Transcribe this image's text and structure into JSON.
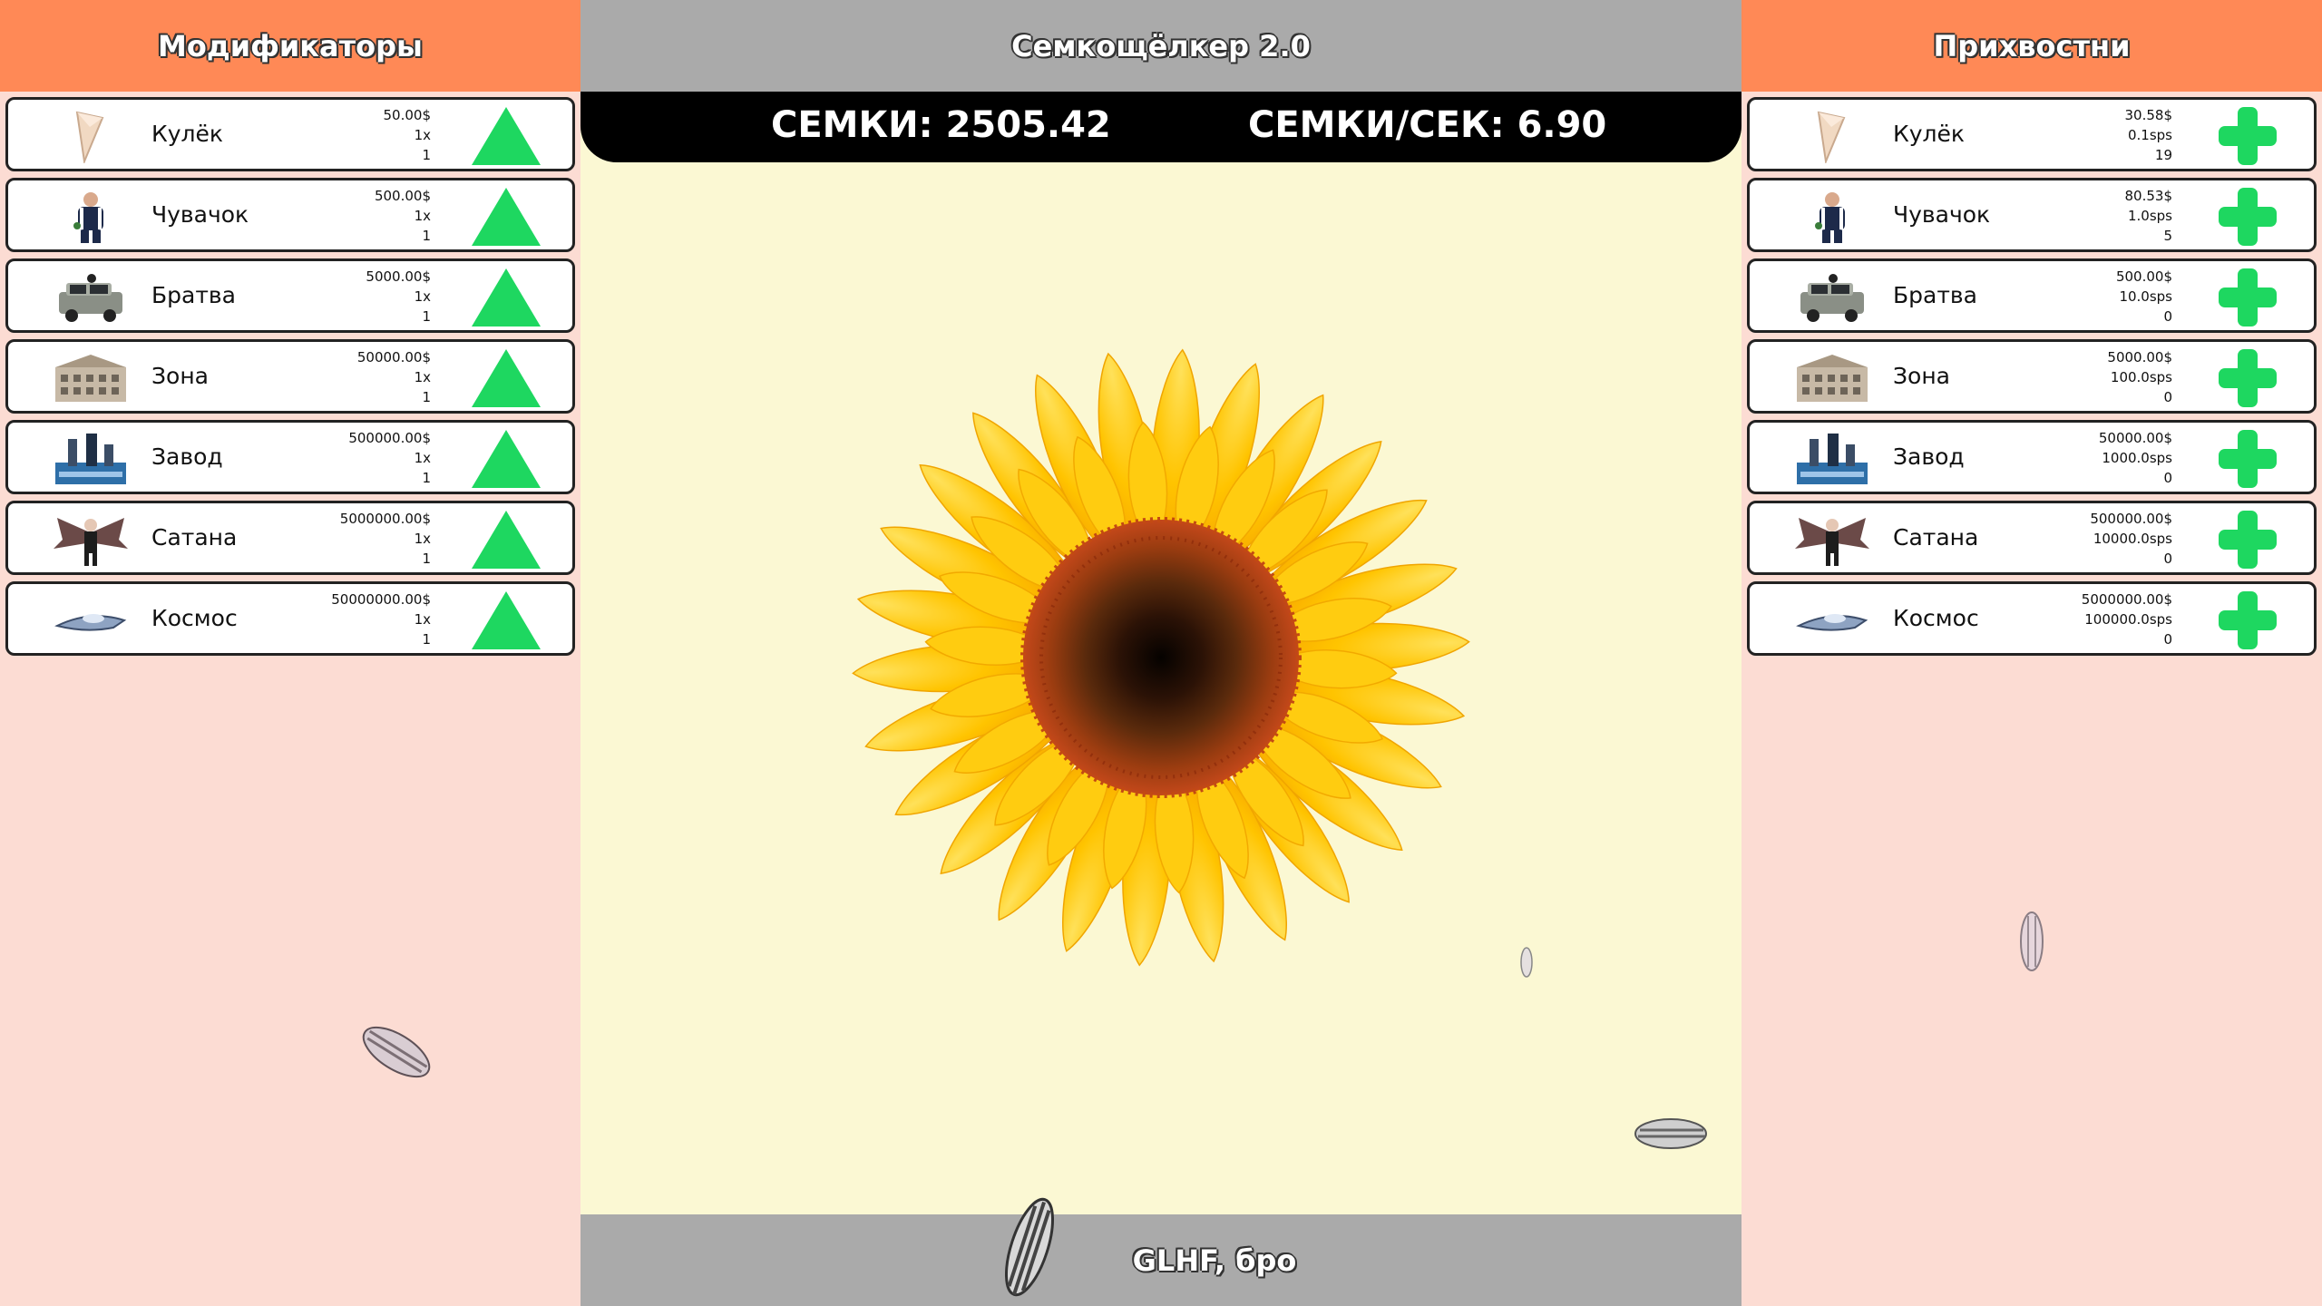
{
  "left_panel": {
    "title": "Модификаторы",
    "items": [
      {
        "name": "Кулёк",
        "cost": "50.00$",
        "mult": "1x",
        "level": "1",
        "icon": "paper-bag-icon"
      },
      {
        "name": "Чувачок",
        "cost": "500.00$",
        "mult": "1x",
        "level": "1",
        "icon": "guy-icon"
      },
      {
        "name": "Братва",
        "cost": "5000.00$",
        "mult": "1x",
        "level": "1",
        "icon": "car-icon"
      },
      {
        "name": "Зона",
        "cost": "50000.00$",
        "mult": "1x",
        "level": "1",
        "icon": "prison-icon"
      },
      {
        "name": "Завод",
        "cost": "500000.00$",
        "mult": "1x",
        "level": "1",
        "icon": "factory-icon"
      },
      {
        "name": "Сатана",
        "cost": "5000000.00$",
        "mult": "1x",
        "level": "1",
        "icon": "satan-icon"
      },
      {
        "name": "Космос",
        "cost": "50000000.00$",
        "mult": "1x",
        "level": "1",
        "icon": "ufo-icon"
      }
    ]
  },
  "right_panel": {
    "title": "Прихвостни",
    "items": [
      {
        "name": "Кулёк",
        "cost": "30.58$",
        "rate": "0.1sps",
        "count": "19",
        "icon": "paper-bag-icon"
      },
      {
        "name": "Чувачок",
        "cost": "80.53$",
        "rate": "1.0sps",
        "count": "5",
        "icon": "guy-icon"
      },
      {
        "name": "Братва",
        "cost": "500.00$",
        "rate": "10.0sps",
        "count": "0",
        "icon": "car-icon"
      },
      {
        "name": "Зона",
        "cost": "5000.00$",
        "rate": "100.0sps",
        "count": "0",
        "icon": "prison-icon"
      },
      {
        "name": "Завод",
        "cost": "50000.00$",
        "rate": "1000.0sps",
        "count": "0",
        "icon": "factory-icon"
      },
      {
        "name": "Сатана",
        "cost": "500000.00$",
        "rate": "10000.0sps",
        "count": "0",
        "icon": "satan-icon"
      },
      {
        "name": "Космос",
        "cost": "5000000.00$",
        "rate": "100000.0sps",
        "count": "0",
        "icon": "ufo-icon"
      }
    ]
  },
  "header": {
    "title": "Семкощёлкер 2.0"
  },
  "stats": {
    "seeds": "СЕМКИ: 2505.42",
    "rate": "СЕМКИ/СЕК: 6.90"
  },
  "footer": {
    "text": "GLHF, бро"
  },
  "colors": {
    "header_orange": "#ff8956",
    "side_bg": "#fcdcd3",
    "center_bg": "#fbf8d3",
    "bar_gray": "#aaaaaa",
    "upgrade_green": "#1ed760"
  }
}
